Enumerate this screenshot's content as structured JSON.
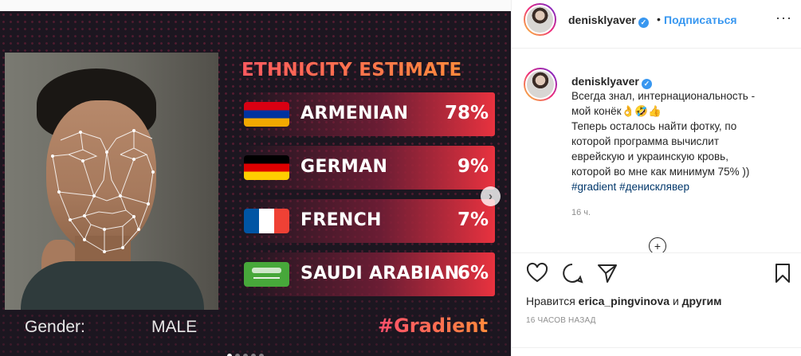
{
  "image": {
    "title": "ETHNICITY ESTIMATE",
    "rows": [
      {
        "name": "ARMENIAN",
        "pct": "78%",
        "flag": "armenia-flag"
      },
      {
        "name": "GERMAN",
        "pct": "9%",
        "flag": "germany-flag"
      },
      {
        "name": "FRENCH",
        "pct": "7%",
        "flag": "france-flag"
      },
      {
        "name": "SAUDI ARABIAN",
        "pct": "6%",
        "flag": "saudi-arabia-flag"
      }
    ],
    "gender_label": "Gender:",
    "gender_value": "MALE",
    "hashtag": "#Gradient",
    "carousel": {
      "count": 5,
      "active": 1
    }
  },
  "header": {
    "username": "denisklyaver",
    "separator": "•",
    "follow": "Подписаться",
    "more": "···"
  },
  "comment": {
    "username": "denisklyaver",
    "caption_lines": [
      "Всегда знал, интернациональность -",
      "мой конёк👌🤣👍",
      "Теперь осталось найти фотку, по",
      "которой программа вычислит",
      "еврейскую и украинскую кровь,",
      "которой во мне как минимум 75% ))"
    ],
    "hashtag1": "#gradient",
    "hashtag2": "#денисклявер",
    "time": "16 ч."
  },
  "actions": {
    "likes_prefix": "Нравится",
    "likes_user": "erica_pingvinova",
    "likes_mid": "и",
    "likes_others": "другим",
    "post_time": "16 ЧАСОВ НАЗАД"
  },
  "colors": {
    "link": "#3897f0",
    "verified": "#3897f0",
    "accent_red": "#e8323f",
    "accent_orange": "#ff8a3c"
  }
}
